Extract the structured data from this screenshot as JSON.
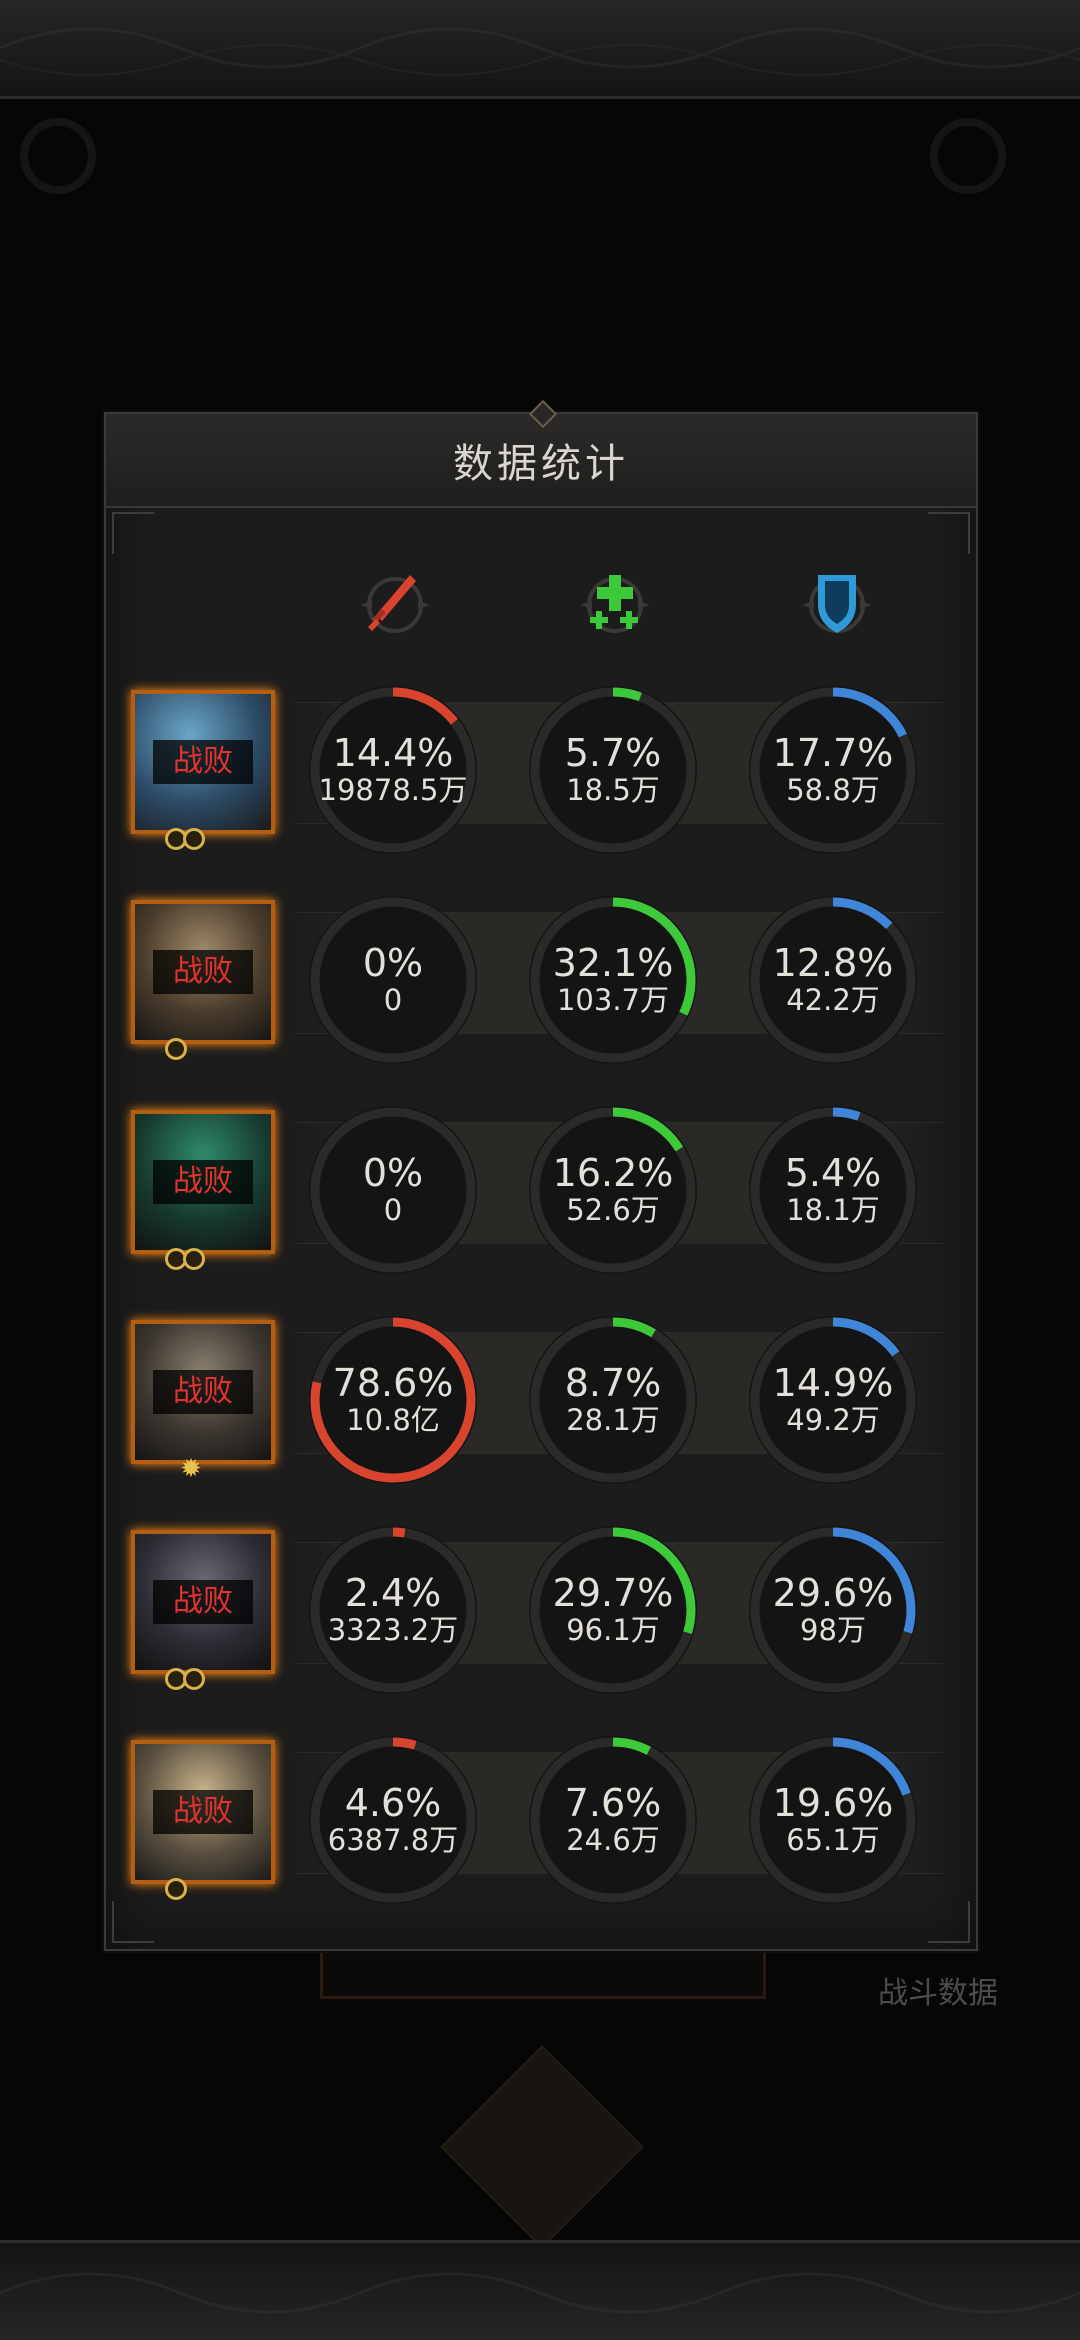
{
  "panel": {
    "title": "数据统计"
  },
  "background": {
    "battle_data_label": "战斗数据"
  },
  "columns": [
    {
      "key": "damage",
      "icon": "sword-icon",
      "color": "#d8442e"
    },
    {
      "key": "heal",
      "icon": "heal-cross-icon",
      "color": "#3ec93a"
    },
    {
      "key": "tank",
      "icon": "shield-icon",
      "color": "#3f86d8"
    }
  ],
  "colors": {
    "damage": "#d8442e",
    "heal": "#3ec93a",
    "tank": "#3f86d8",
    "avatar_border": "#b45e12",
    "defeat_text": "#e2342e"
  },
  "rows": [
    {
      "status": "战败",
      "stars": 2,
      "badge": "coins",
      "stats": [
        {
          "pct": "14.4%",
          "amount": "19878.5万",
          "value": 14.4
        },
        {
          "pct": "5.7%",
          "amount": "18.5万",
          "value": 5.7
        },
        {
          "pct": "17.7%",
          "amount": "58.8万",
          "value": 17.7
        }
      ]
    },
    {
      "status": "战败",
      "stars": 1,
      "badge": "coins",
      "stats": [
        {
          "pct": "0%",
          "amount": "0",
          "value": 0
        },
        {
          "pct": "32.1%",
          "amount": "103.7万",
          "value": 32.1
        },
        {
          "pct": "12.8%",
          "amount": "42.2万",
          "value": 12.8
        }
      ]
    },
    {
      "status": "战败",
      "stars": 2,
      "badge": "coins",
      "stats": [
        {
          "pct": "0%",
          "amount": "0",
          "value": 0
        },
        {
          "pct": "16.2%",
          "amount": "52.6万",
          "value": 16.2
        },
        {
          "pct": "5.4%",
          "amount": "18.1万",
          "value": 5.4
        }
      ]
    },
    {
      "status": "战败",
      "stars": 0,
      "badge": "sun",
      "stats": [
        {
          "pct": "78.6%",
          "amount": "10.8亿",
          "value": 78.6
        },
        {
          "pct": "8.7%",
          "amount": "28.1万",
          "value": 8.7
        },
        {
          "pct": "14.9%",
          "amount": "49.2万",
          "value": 14.9
        }
      ]
    },
    {
      "status": "战败",
      "stars": 2,
      "badge": "coins",
      "stats": [
        {
          "pct": "2.4%",
          "amount": "3323.2万",
          "value": 2.4
        },
        {
          "pct": "29.7%",
          "amount": "96.1万",
          "value": 29.7
        },
        {
          "pct": "29.6%",
          "amount": "98万",
          "value": 29.6
        }
      ]
    },
    {
      "status": "战败",
      "stars": 1,
      "badge": "coins",
      "stats": [
        {
          "pct": "4.6%",
          "amount": "6387.8万",
          "value": 4.6
        },
        {
          "pct": "7.6%",
          "amount": "24.6万",
          "value": 7.6
        },
        {
          "pct": "19.6%",
          "amount": "65.1万",
          "value": 19.6
        }
      ]
    }
  ]
}
